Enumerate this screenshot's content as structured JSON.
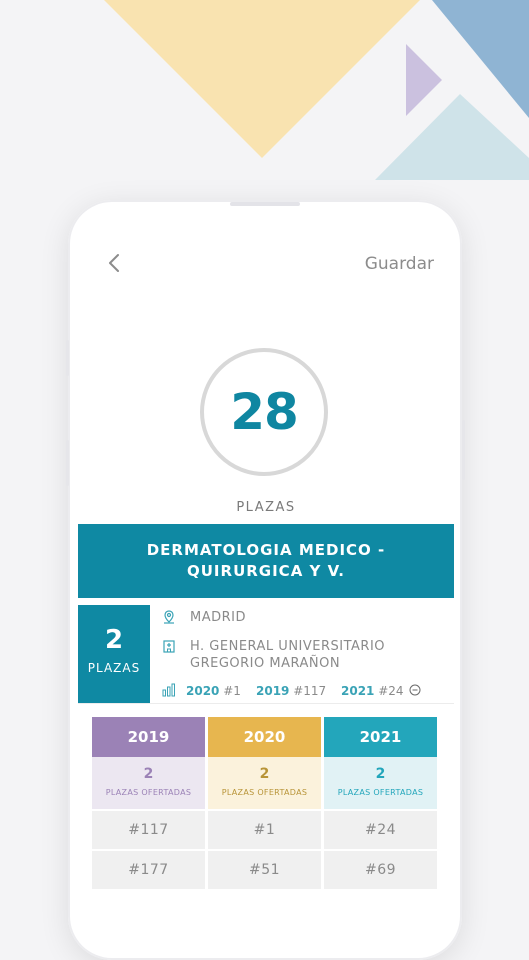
{
  "colors": {
    "accent": "#0f89a3",
    "year_2019": "#9b82b6",
    "year_2020": "#e7b64f",
    "year_2021": "#23a6bb"
  },
  "header": {
    "back_icon": "chevron-left-icon",
    "save_label": "Guardar"
  },
  "summary": {
    "total": "28",
    "total_label": "PLAZAS"
  },
  "specialty": {
    "title": "DERMATOLOGIA MEDICO - QUIRURGICA Y V."
  },
  "hospital": {
    "count": "2",
    "count_label": "PLAZAS",
    "city": "MADRID",
    "name_line1": "H. GENERAL UNIVERSITARIO",
    "name_line2": "GREGORIO MARAÑON",
    "history": [
      {
        "year": "2020",
        "rank": "#1"
      },
      {
        "year": "2019",
        "rank": "#117"
      },
      {
        "year": "2021",
        "rank": "#24"
      }
    ]
  },
  "table": {
    "columns": [
      {
        "year": "2019",
        "plazas": "2",
        "plazas_label": "PLAZAS OFERTADAS",
        "rows": [
          "#117",
          "#177"
        ]
      },
      {
        "year": "2020",
        "plazas": "2",
        "plazas_label": "PLAZAS OFERTADAS",
        "rows": [
          "#1",
          "#51"
        ]
      },
      {
        "year": "2021",
        "plazas": "2",
        "plazas_label": "PLAZAS OFERTADAS",
        "rows": [
          "#24",
          "#69"
        ]
      }
    ]
  }
}
